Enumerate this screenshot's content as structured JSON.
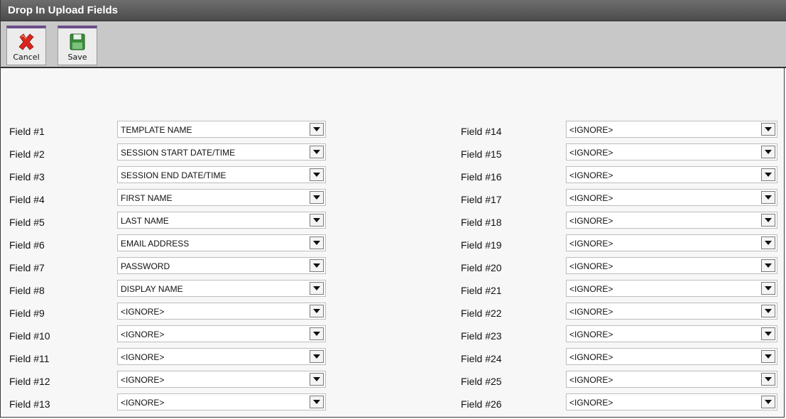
{
  "window": {
    "title": "Drop In Upload Fields"
  },
  "toolbar": {
    "cancel_label": "Cancel",
    "save_label": "Save"
  },
  "fields_left": [
    {
      "label": "Field #1",
      "value": "TEMPLATE NAME"
    },
    {
      "label": "Field #2",
      "value": "SESSION START DATE/TIME"
    },
    {
      "label": "Field #3",
      "value": "SESSION END DATE/TIME"
    },
    {
      "label": "Field #4",
      "value": "FIRST NAME"
    },
    {
      "label": "Field #5",
      "value": "LAST NAME"
    },
    {
      "label": "Field #6",
      "value": "EMAIL ADDRESS"
    },
    {
      "label": "Field #7",
      "value": "PASSWORD"
    },
    {
      "label": "Field #8",
      "value": "DISPLAY NAME"
    },
    {
      "label": "Field #9",
      "value": "<IGNORE>"
    },
    {
      "label": "Field #10",
      "value": "<IGNORE>"
    },
    {
      "label": "Field #11",
      "value": "<IGNORE>"
    },
    {
      "label": "Field #12",
      "value": "<IGNORE>"
    },
    {
      "label": "Field #13",
      "value": "<IGNORE>"
    }
  ],
  "fields_right": [
    {
      "label": "Field #14",
      "value": "<IGNORE>"
    },
    {
      "label": "Field #15",
      "value": "<IGNORE>"
    },
    {
      "label": "Field #16",
      "value": "<IGNORE>"
    },
    {
      "label": "Field #17",
      "value": "<IGNORE>"
    },
    {
      "label": "Field #18",
      "value": "<IGNORE>"
    },
    {
      "label": "Field #19",
      "value": "<IGNORE>"
    },
    {
      "label": "Field #20",
      "value": "<IGNORE>"
    },
    {
      "label": "Field #21",
      "value": "<IGNORE>"
    },
    {
      "label": "Field #22",
      "value": "<IGNORE>"
    },
    {
      "label": "Field #23",
      "value": "<IGNORE>"
    },
    {
      "label": "Field #24",
      "value": "<IGNORE>"
    },
    {
      "label": "Field #25",
      "value": "<IGNORE>"
    },
    {
      "label": "Field #26",
      "value": "<IGNORE>"
    }
  ],
  "icons": {
    "cancel": "red-x-icon",
    "save": "floppy-disk-icon"
  },
  "colors": {
    "titlebar": "#5a5a5a",
    "toolbar": "#c8c8c8",
    "cancel_icon": "#d9261c",
    "save_icon": "#3a8f3a"
  }
}
